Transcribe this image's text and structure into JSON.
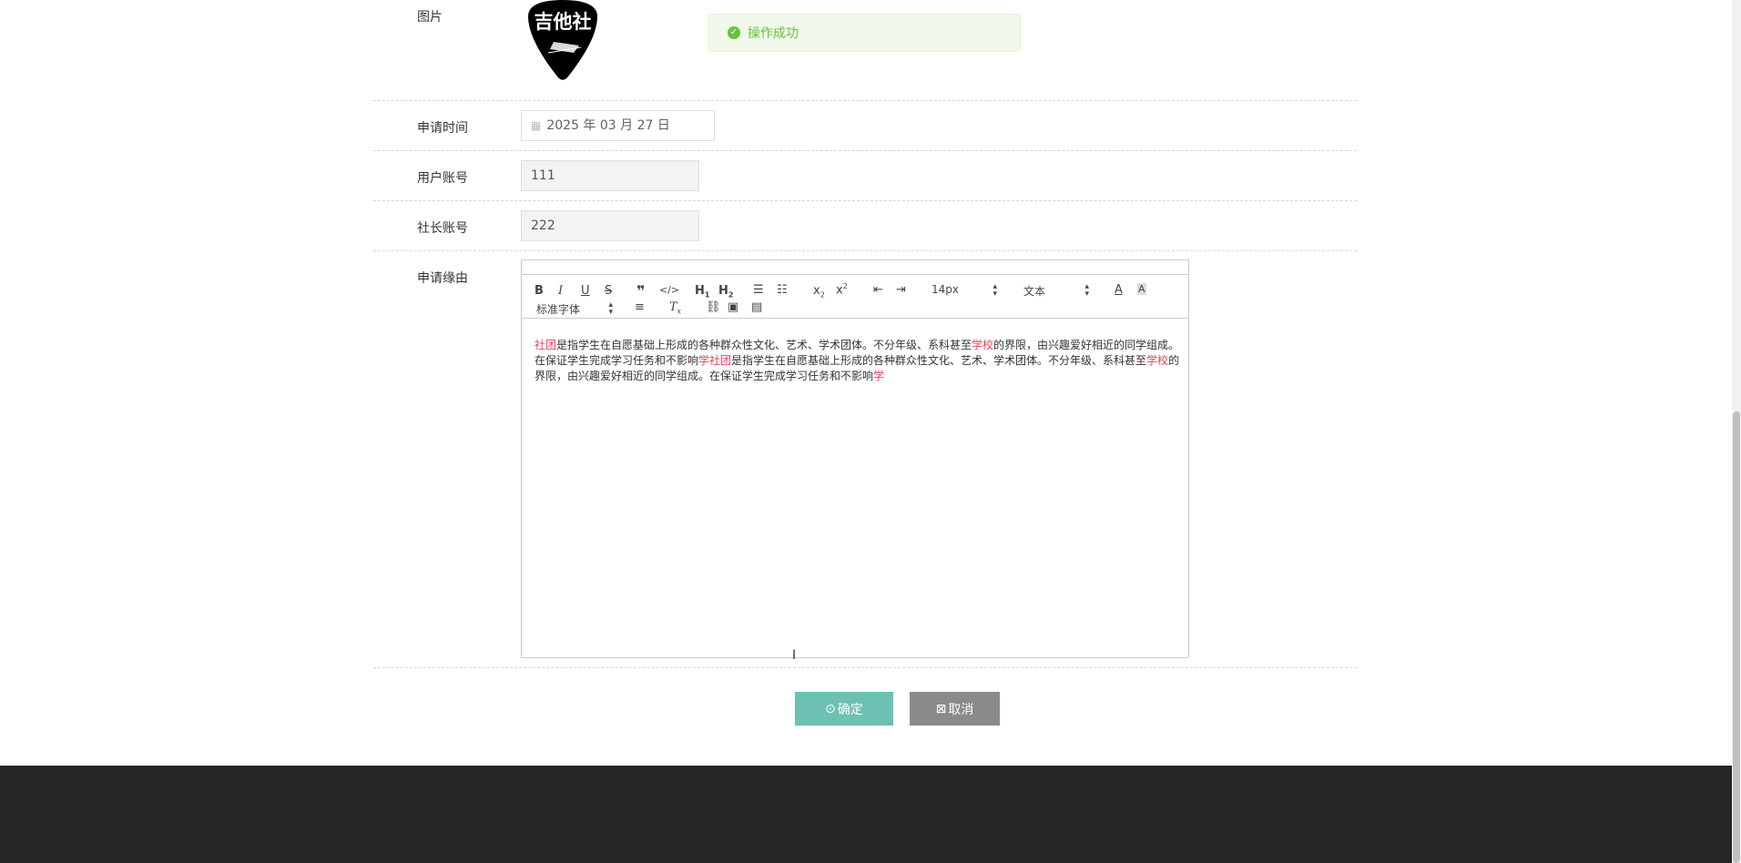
{
  "form": {
    "image_label": "图片",
    "logo_text": "吉他社",
    "apply_time_label": "申请时间",
    "apply_time_value": "2025 年 03 月 27 日",
    "user_account_label": "用户账号",
    "user_account_value": "111",
    "president_account_label": "社长账号",
    "president_account_value": "222",
    "reason_label": "申请缘由"
  },
  "toast": {
    "message": "操作成功",
    "type": "success",
    "color": "#67c23a"
  },
  "editor": {
    "font_size": "14px",
    "header_select": "文本",
    "font_family": "标准字体",
    "content_segments": [
      {
        "text": "社团",
        "highlight": true
      },
      {
        "text": "是指学生在自愿基础上形成的各种群众性文化、艺术、学术团体。不分年级、系科甚至",
        "highlight": false
      },
      {
        "text": "学校",
        "highlight": true
      },
      {
        "text": "的界限，由兴趣爱好相近的同学组成。在保证学生完成学习任务和不影响",
        "highlight": false
      },
      {
        "text": "学社团",
        "highlight": true
      },
      {
        "text": "是指学生在自愿基础上形成的各种群众性文化、艺术、学术团体。不分年级、系科甚至",
        "highlight": false
      },
      {
        "text": "学校",
        "highlight": true
      },
      {
        "text": "的界限，由兴趣爱好相近的同学组成。在保证学生完成学习任务和不影响",
        "highlight": false
      },
      {
        "text": "学",
        "highlight": true
      }
    ]
  },
  "buttons": {
    "confirm_label": "确定",
    "cancel_label": "取消",
    "confirm_color": "#6cc1b3",
    "cancel_color": "#8a8a8a"
  }
}
